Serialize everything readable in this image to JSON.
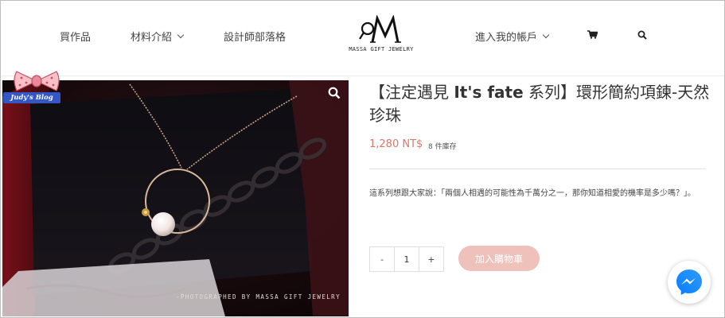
{
  "nav": {
    "left_items": [
      {
        "label": "買作品"
      },
      {
        "label": "材料介紹"
      },
      {
        "label": "設計師部落格"
      }
    ],
    "account_label": "進入我的帳戶",
    "cart_icon": "cart-icon",
    "search_icon": "search-icon"
  },
  "logo": {
    "mark": "M",
    "text": "MASSA GIFT JEWELRY"
  },
  "badge": {
    "label": "Judy's Blog"
  },
  "product": {
    "title_open": "【注定遇見 ",
    "title_bold": "It's fate",
    "title_rest": " 系列】環形簡約項鍊-天然珍珠",
    "price": "1,280 NT$",
    "stock": "8 件庫存",
    "description": "這系列想跟大家說：「兩個人相遇的可能性為千萬分之一，那你知道相愛的機率是多少嗎？」。",
    "photo_credit": "-PHOTOGRAPHED BY MASSA GIFT JEWELRY"
  },
  "purchase": {
    "minus": "-",
    "quantity": "1",
    "plus": "+",
    "add_to_cart": "加入購物車"
  },
  "colors": {
    "price": "#d9786b",
    "cart_button": "#eec1bb",
    "messenger": "#1877f2"
  }
}
